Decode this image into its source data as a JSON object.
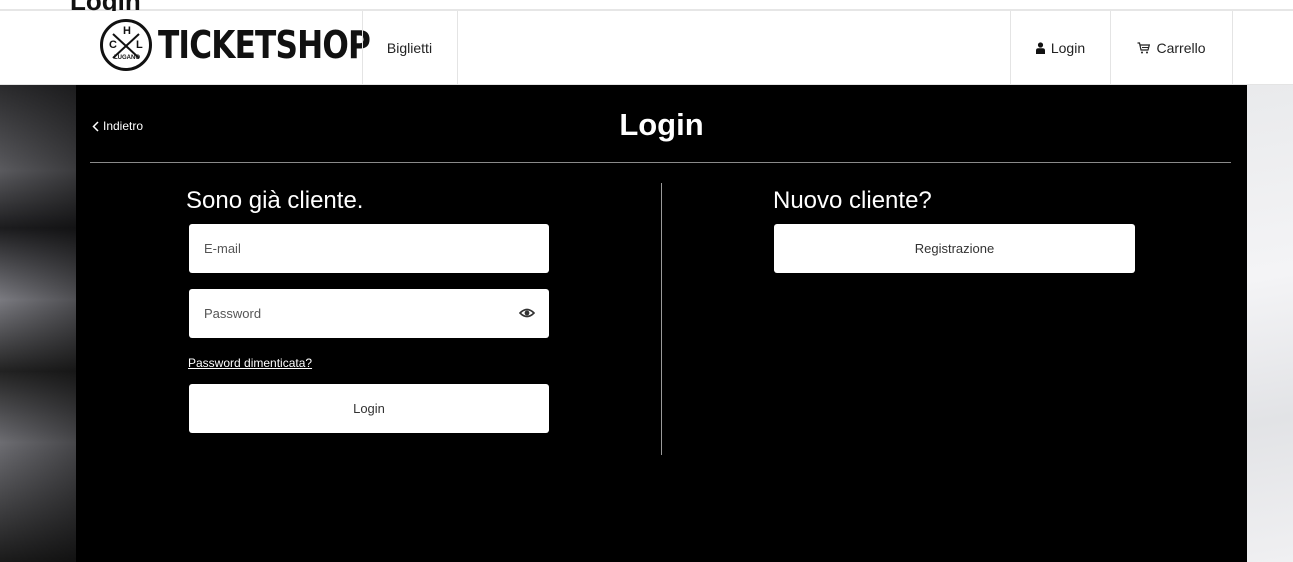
{
  "page": {
    "cut_heading": "Login"
  },
  "header": {
    "logo": {
      "brand": "TICKETSHOP",
      "badge_letters": [
        "C",
        "H",
        "L",
        "LUGANO"
      ]
    },
    "nav": {
      "tickets_label": "Biglietti"
    },
    "login_label": "Login",
    "cart_label": "Carrello",
    "icons": {
      "user": "user-icon",
      "cart": "cart-icon"
    }
  },
  "main": {
    "back_label": "Indietro",
    "title": "Login",
    "existing": {
      "heading": "Sono già cliente.",
      "email_placeholder": "E-mail",
      "password_placeholder": "Password",
      "forgot_label": "Password dimenticata?",
      "login_button": "Login"
    },
    "new": {
      "heading": "Nuovo cliente?",
      "register_button": "Registrazione"
    }
  },
  "colors": {
    "panel_bg": "#000000",
    "header_bg": "#ffffff",
    "field_bg": "#ffffff"
  }
}
